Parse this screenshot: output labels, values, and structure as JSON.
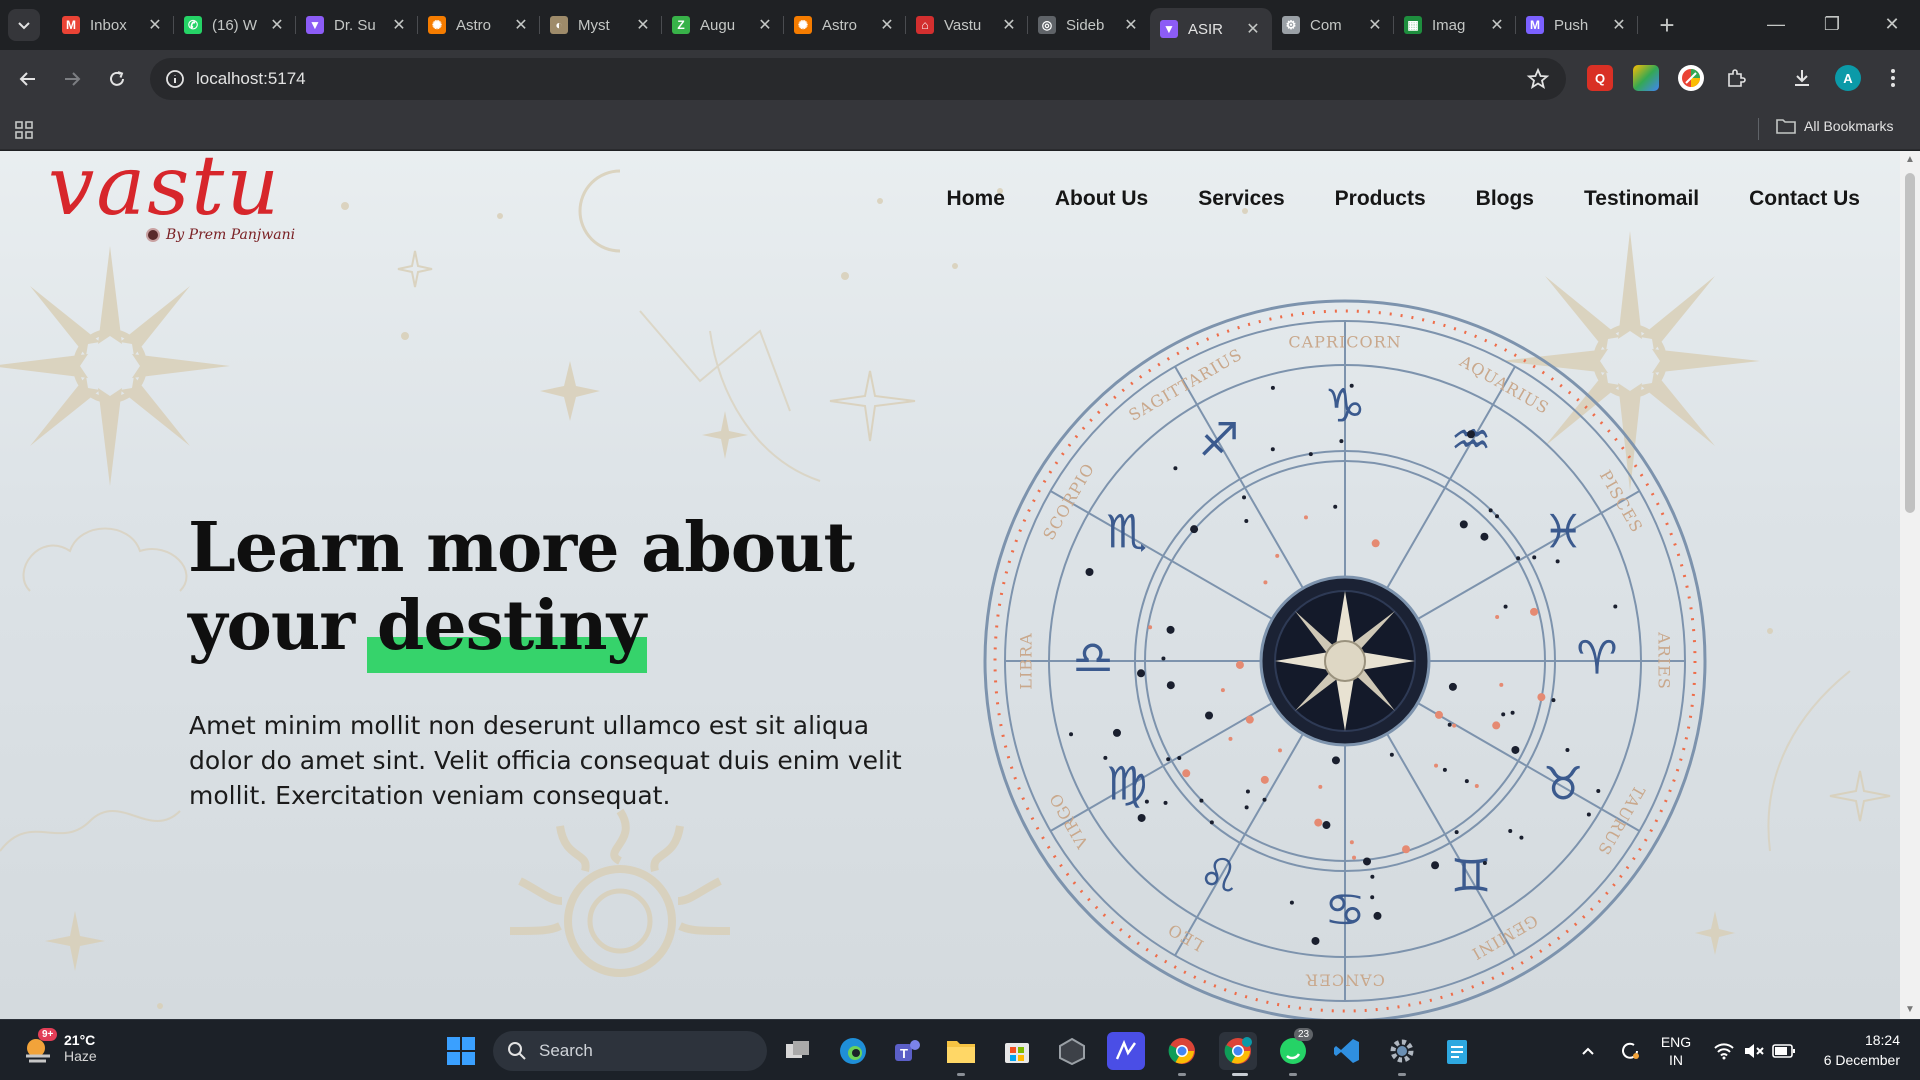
{
  "browser": {
    "tabs": [
      {
        "title": "Inbox",
        "favicon": "gmail-icon",
        "color": "#ea4335",
        "glyph": "M"
      },
      {
        "title": "(16) W",
        "favicon": "whatsapp-icon",
        "color": "#25d366",
        "glyph": "✆"
      },
      {
        "title": "Dr. Su",
        "favicon": "vite-icon",
        "color": "#8c5cf6",
        "glyph": "▼"
      },
      {
        "title": "Astro",
        "favicon": "sun-icon",
        "color": "#f57c00",
        "glyph": "✺"
      },
      {
        "title": "Myst",
        "favicon": "moon-icon",
        "color": "#9e8b6a",
        "glyph": "◐"
      },
      {
        "title": "Augu",
        "favicon": "envato-icon",
        "color": "#38b249",
        "glyph": "Z"
      },
      {
        "title": "Astro",
        "favicon": "sun-icon",
        "color": "#f57c00",
        "glyph": "✺"
      },
      {
        "title": "Vastu",
        "favicon": "home-icon",
        "color": "#d32f2f",
        "glyph": "⌂"
      },
      {
        "title": "Sideb",
        "favicon": "openai-icon",
        "color": "#5f6368",
        "glyph": "◎"
      },
      {
        "title": "ASIR",
        "favicon": "vite-icon",
        "color": "#8c5cf6",
        "glyph": "▼",
        "active": true
      },
      {
        "title": "Com",
        "favicon": "gear-icon",
        "color": "#9aa0a6",
        "glyph": "⚙"
      },
      {
        "title": "Imag",
        "favicon": "sheets-icon",
        "color": "#1e8e3e",
        "glyph": "▦"
      },
      {
        "title": "Push",
        "favicon": "gmail-icon",
        "color": "#7b61ff",
        "glyph": "M"
      }
    ],
    "url": "localhost:5174",
    "bookmarks_label": "All Bookmarks",
    "profile_letter": "A"
  },
  "site": {
    "logo": {
      "text": "vastu",
      "sub": "By Prem Panjwani"
    },
    "nav": [
      "Home",
      "About Us",
      "Services",
      "Products",
      "Blogs",
      "Testinomail",
      "Contact Us"
    ],
    "hero": {
      "title_line1": "Learn more about",
      "title_line2_a": "your",
      "title_line2_highlight": "destiny",
      "description": "Amet minim mollit non deserunt ullamco est sit aliqua dolor do amet sint. Velit officia consequat duis enim velit mollit. Exercitation veniam consequat."
    },
    "zodiac": {
      "signs": [
        "CAPRICORN",
        "AQUARIUS",
        "PISCES",
        "ARIES",
        "TAURUS",
        "GEMINI",
        "CANCER",
        "LEO",
        "VIRGO",
        "LIBRA",
        "SCORPIO",
        "SAGITTARIUS"
      ],
      "glyphs": [
        "♑",
        "♒",
        "♓",
        "♈",
        "♉",
        "♊",
        "♋",
        "♌",
        "♍",
        "♎",
        "♏",
        "♐"
      ]
    },
    "colors": {
      "accent_highlight": "#36d36b",
      "logo_red": "#d7262b"
    }
  },
  "taskbar": {
    "weather_temp": "21°C",
    "weather_desc": "Haze",
    "weather_badge": "9+",
    "search_label": "Search",
    "whatsapp_badge": "23",
    "lang_line1": "ENG",
    "lang_line2": "IN",
    "time": "18:24",
    "date": "6 December"
  }
}
